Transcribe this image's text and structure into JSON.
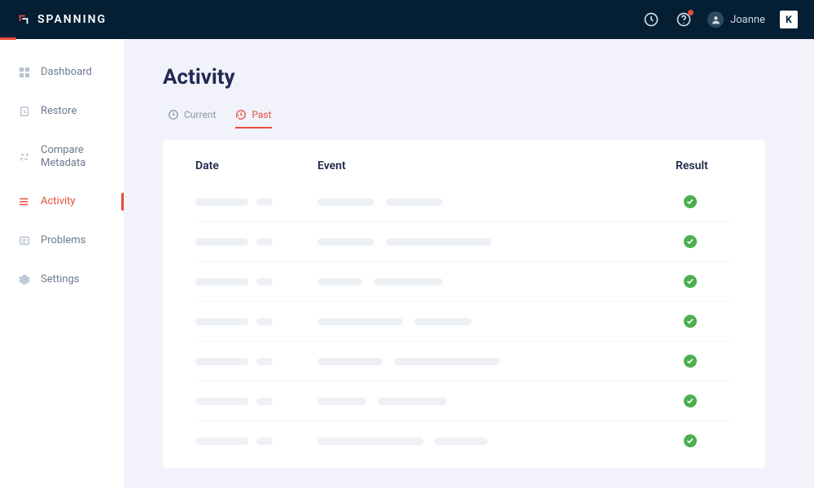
{
  "brand": {
    "name": "SPANNING",
    "kaseya_mark": "K"
  },
  "user": {
    "name": "Joanne"
  },
  "sidebar": {
    "items": [
      {
        "label": "Dashboard",
        "icon": "dashboard"
      },
      {
        "label": "Restore",
        "icon": "restore"
      },
      {
        "label": "Compare Metadata",
        "icon": "compare"
      },
      {
        "label": "Activity",
        "icon": "activity",
        "active": true
      },
      {
        "label": "Problems",
        "icon": "problems"
      },
      {
        "label": "Settings",
        "icon": "settings"
      }
    ]
  },
  "page": {
    "title": "Activity"
  },
  "tabs": {
    "current": {
      "label": "Current"
    },
    "past": {
      "label": "Past",
      "active": true
    }
  },
  "table": {
    "columns": {
      "date": "Date",
      "event": "Event",
      "result": "Result"
    },
    "rows": [
      {
        "date_w": [
          65,
          20
        ],
        "event_w": [
          70,
          70
        ],
        "result": "success"
      },
      {
        "date_w": [
          65,
          20
        ],
        "event_w": [
          70,
          130
        ],
        "result": "success"
      },
      {
        "date_w": [
          65,
          20
        ],
        "event_w": [
          55,
          85
        ],
        "result": "success"
      },
      {
        "date_w": [
          65,
          20
        ],
        "event_w": [
          105,
          70
        ],
        "result": "success"
      },
      {
        "date_w": [
          65,
          20
        ],
        "event_w": [
          80,
          130
        ],
        "result": "success"
      },
      {
        "date_w": [
          65,
          20
        ],
        "event_w": [
          60,
          85
        ],
        "result": "success"
      },
      {
        "date_w": [
          65,
          20
        ],
        "event_w": [
          130,
          65
        ],
        "result": "success"
      }
    ]
  },
  "colors": {
    "accent": "#e74c3c",
    "success": "#4caf50",
    "navy": "#041e34"
  }
}
